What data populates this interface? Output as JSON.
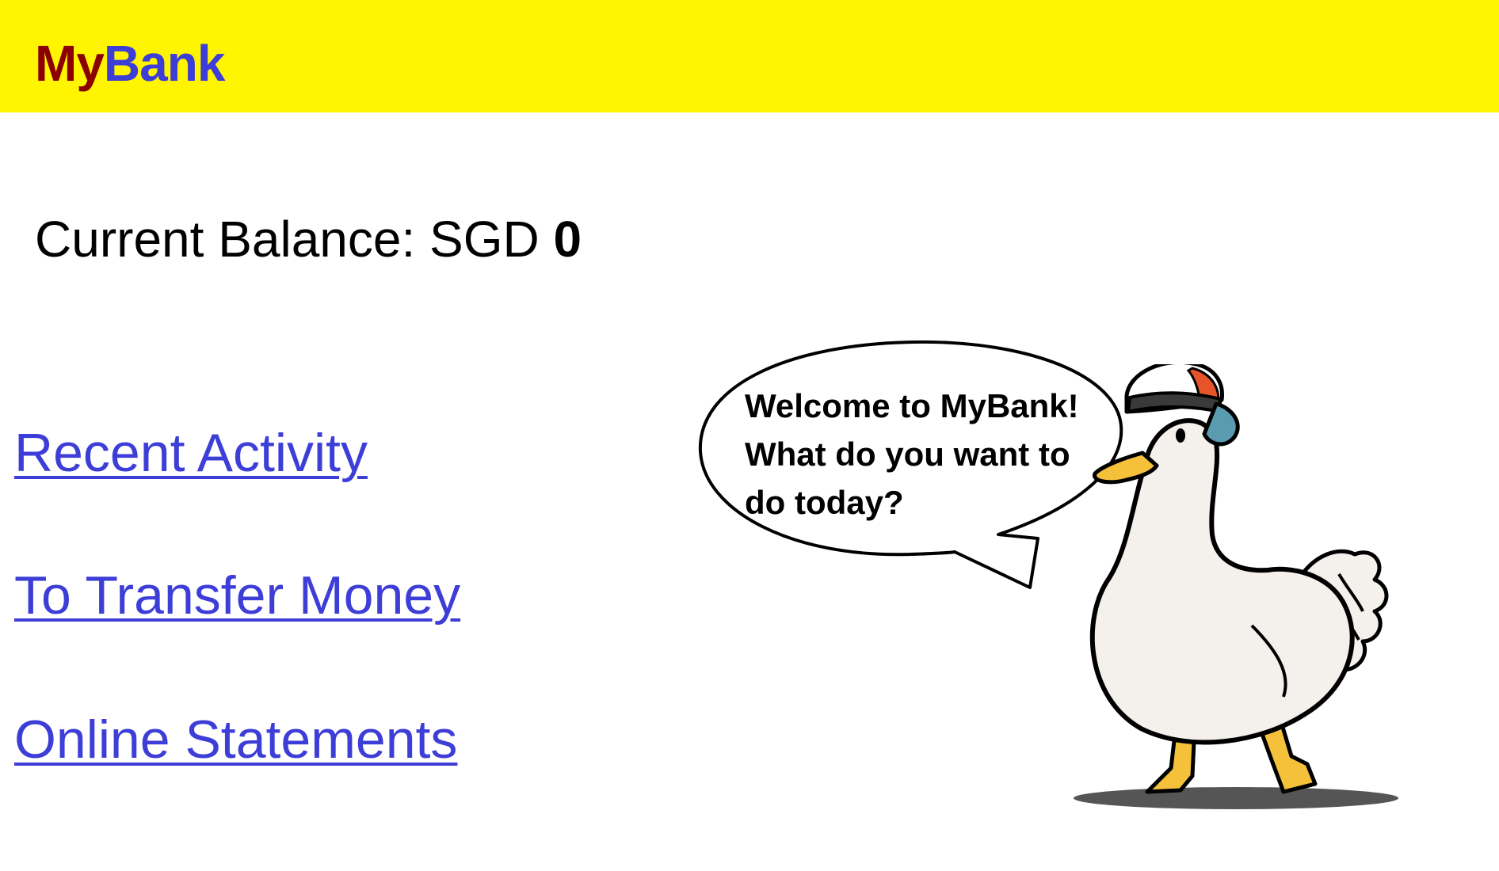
{
  "header": {
    "logo_part1": "My",
    "logo_part2": "Bank",
    "colors": {
      "bar": "#fff500",
      "logo_my": "#8b0000",
      "logo_bank": "#3d3dd8"
    }
  },
  "balance": {
    "label": "Current Balance: SGD ",
    "amount": "0"
  },
  "nav": {
    "links": [
      {
        "label": "Recent Activity"
      },
      {
        "label": "To Transfer Money"
      },
      {
        "label": "Online Statements"
      }
    ],
    "link_color": "#3d3dd8"
  },
  "mascot": {
    "icon": "duck-mascot-icon",
    "speech_lines": [
      "Welcome to MyBank!",
      "What do you want to",
      "do today?"
    ]
  }
}
